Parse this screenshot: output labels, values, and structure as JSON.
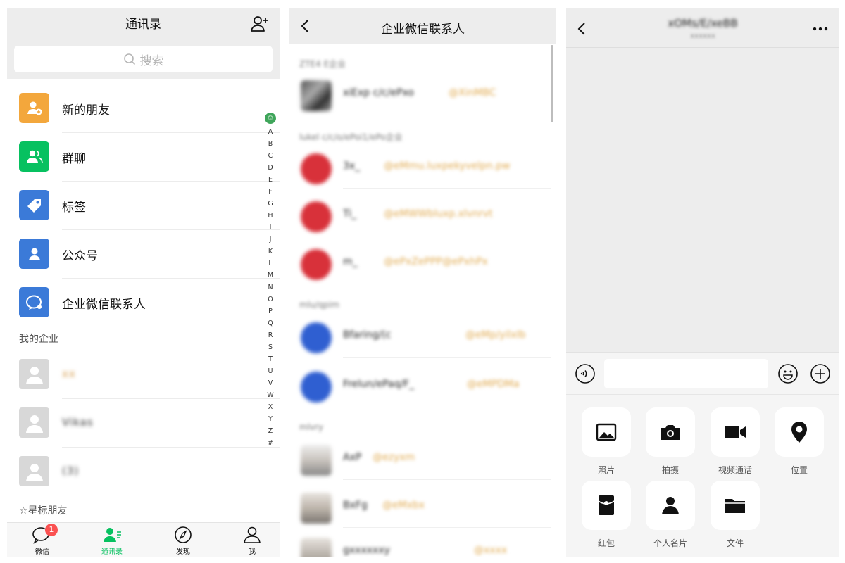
{
  "contacts_panel": {
    "title": "通讯录",
    "search_placeholder": "搜索",
    "menu": [
      {
        "label": "新的朋友",
        "color": "#f3a73c",
        "icon": "new-friend-icon"
      },
      {
        "label": "群聊",
        "color": "#07c160",
        "icon": "group-chat-icon"
      },
      {
        "label": "标签",
        "color": "#3b7ad8",
        "icon": "tag-icon"
      },
      {
        "label": "公众号",
        "color": "#3b7ad8",
        "icon": "official-account-icon"
      },
      {
        "label": "企业微信联系人",
        "color": "#3b7ad8",
        "icon": "enterprise-contact-icon"
      }
    ],
    "my_enterprise_label": "我的企业",
    "enterprises": [
      "xx",
      "Vikas",
      "(3)"
    ],
    "starred_label": "☆星标朋友",
    "alphabet": [
      "A",
      "B",
      "C",
      "D",
      "E",
      "F",
      "G",
      "H",
      "I",
      "J",
      "K",
      "L",
      "M",
      "N",
      "O",
      "P",
      "Q",
      "R",
      "S",
      "T",
      "U",
      "V",
      "W",
      "X",
      "Y",
      "Z",
      "#"
    ],
    "tabs": [
      {
        "label": "微信",
        "badge": "1"
      },
      {
        "label": "通讯录",
        "active": true
      },
      {
        "label": "发现"
      },
      {
        "label": "我"
      }
    ],
    "accent_color": "#07c160"
  },
  "enterprise_panel": {
    "title": "企业微信联系人",
    "groups": [
      {
        "header": "ZTE4 E企业",
        "contacts": [
          {
            "name": "xiExp c/c/ePxo",
            "company": "@XinMBC"
          }
        ]
      },
      {
        "header": "lukel c/c/o/ePoi1/ePo企业",
        "contacts": [
          {
            "name": "3x_",
            "company": "@eMmu.luxpekyvelpn.pw",
            "avatar_color": "#d8313a"
          },
          {
            "name": "Ti_",
            "company": "@eMWWbluxp.xlvnrvt",
            "avatar_color": "#d8313a"
          },
          {
            "name": "m_",
            "company": "@ePxZePPP@ePxhPx",
            "avatar_color": "#d8313a"
          }
        ]
      },
      {
        "header": "mlu/qpim",
        "contacts": [
          {
            "name": "Bfaring/(c",
            "company": "@eMp/yilxIb",
            "avatar_color": "#2f5fd1"
          },
          {
            "name": "Frelun/ePaq/F_",
            "company": "@eMPDMa",
            "avatar_color": "#2f5fd1"
          }
        ]
      },
      {
        "header": "mlvry",
        "contacts": [
          {
            "name": "AxP",
            "company": "@ezyxm",
            "avatar_color": "#c9c3bd"
          },
          {
            "name": "BxFg",
            "company": "@eMxbx",
            "avatar_color": "#b8b0a6"
          },
          {
            "name": "gxxxxxxy",
            "company": "@xxxx",
            "avatar_color": "#b5aea6"
          }
        ]
      }
    ]
  },
  "chat_panel": {
    "title": "xOMs/E/xeBB",
    "subtitle": "xxxxxx",
    "attachments": [
      {
        "label": "照片",
        "icon": "photo-icon"
      },
      {
        "label": "拍摄",
        "icon": "camera-icon"
      },
      {
        "label": "视频通话",
        "icon": "video-call-icon"
      },
      {
        "label": "位置",
        "icon": "location-icon"
      },
      {
        "label": "红包",
        "icon": "red-packet-icon"
      },
      {
        "label": "个人名片",
        "icon": "contact-card-icon"
      },
      {
        "label": "文件",
        "icon": "file-icon"
      }
    ]
  }
}
